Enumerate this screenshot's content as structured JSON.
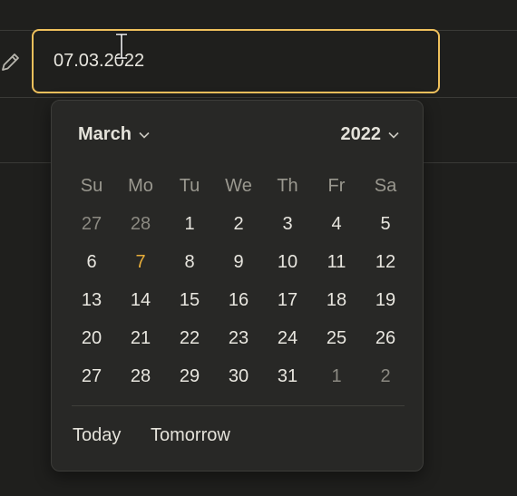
{
  "date_field": {
    "value": "07.03.2022"
  },
  "calendar": {
    "month": "March",
    "year": "2022",
    "weekdays": [
      "Su",
      "Mo",
      "Tu",
      "We",
      "Th",
      "Fr",
      "Sa"
    ],
    "weeks": [
      [
        {
          "d": "27",
          "cur": false
        },
        {
          "d": "28",
          "cur": false
        },
        {
          "d": "1",
          "cur": true
        },
        {
          "d": "2",
          "cur": true
        },
        {
          "d": "3",
          "cur": true
        },
        {
          "d": "4",
          "cur": true
        },
        {
          "d": "5",
          "cur": true
        }
      ],
      [
        {
          "d": "6",
          "cur": true
        },
        {
          "d": "7",
          "cur": true,
          "today": true
        },
        {
          "d": "8",
          "cur": true
        },
        {
          "d": "9",
          "cur": true
        },
        {
          "d": "10",
          "cur": true
        },
        {
          "d": "11",
          "cur": true
        },
        {
          "d": "12",
          "cur": true
        }
      ],
      [
        {
          "d": "13",
          "cur": true
        },
        {
          "d": "14",
          "cur": true
        },
        {
          "d": "15",
          "cur": true
        },
        {
          "d": "16",
          "cur": true
        },
        {
          "d": "17",
          "cur": true
        },
        {
          "d": "18",
          "cur": true
        },
        {
          "d": "19",
          "cur": true
        }
      ],
      [
        {
          "d": "20",
          "cur": true
        },
        {
          "d": "21",
          "cur": true
        },
        {
          "d": "22",
          "cur": true
        },
        {
          "d": "23",
          "cur": true
        },
        {
          "d": "24",
          "cur": true
        },
        {
          "d": "25",
          "cur": true
        },
        {
          "d": "26",
          "cur": true
        }
      ],
      [
        {
          "d": "27",
          "cur": true
        },
        {
          "d": "28",
          "cur": true
        },
        {
          "d": "29",
          "cur": true
        },
        {
          "d": "30",
          "cur": true
        },
        {
          "d": "31",
          "cur": true
        },
        {
          "d": "1",
          "cur": false
        },
        {
          "d": "2",
          "cur": false
        }
      ]
    ]
  },
  "quick_actions": {
    "today_label": "Today",
    "tomorrow_label": "Tomorrow"
  },
  "colors": {
    "accent": "#efc05c",
    "highlight_day": "#e8ae3a"
  },
  "icons": {
    "edit": "pencil-icon",
    "cursor": "text-cursor-icon",
    "dropdown": "chevron-down-icon"
  }
}
